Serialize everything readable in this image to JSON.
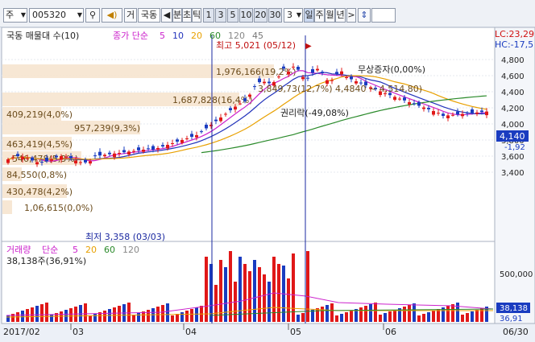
{
  "toolbar": {
    "market_select": "주",
    "code_input": "005320",
    "search_icon_name": "magnifier-icon",
    "sound_icon_name": "speaker-icon",
    "trade_btn": "거",
    "stock_name": "국동",
    "prev_arrow": "◀",
    "tick_btn": "분",
    "tick_btn2": "초",
    "tick_btn3": "틱",
    "periods": [
      "1",
      "3",
      "5",
      "10",
      "20",
      "30"
    ],
    "count_value": "3",
    "day_btn": "일",
    "week_btn": "주",
    "month_btn": "월",
    "year_btn": "년",
    "next_arrow": ">",
    "updown_icon_name": "updown-arrows-icon"
  },
  "price_panel": {
    "title": "국동 매물대 수(10)",
    "ma_label": "종가 단순",
    "ma_periods": [
      {
        "label": "5",
        "color": "#cc22cc"
      },
      {
        "label": "10",
        "color": "#2233bb"
      },
      {
        "label": "20",
        "color": "#e8a000"
      },
      {
        "label": "60",
        "color": "#2a8a2a"
      },
      {
        "label": "120",
        "color": "#888888"
      },
      {
        "label": "45",
        "color": "#777777"
      }
    ],
    "lc_label": "LC:23,29",
    "hc_label": "HC:-17,5",
    "high_annot": "최고 5,021 (05/12)",
    "low_annot": "최저 3,358 (03/03)",
    "bonus_annot": "무상증자(0,00%)",
    "rights_annot": "권리락(-49,08%)",
    "current_price": "4,140",
    "change_label": "-1,92",
    "y_ticks": [
      "4,800",
      "4,600",
      "4,400",
      "4,200",
      "4,000",
      "3,800",
      "3,600",
      "3,400"
    ],
    "volume_profile": [
      {
        "label": "1,976,166(19,2%)",
        "frac": 0.55
      },
      {
        "label": "1,687,828(16,4%)",
        "frac": 0.48
      },
      {
        "label": "409,219(4,0%)",
        "frac": 0.12
      },
      {
        "label": "957,239(9,3%)",
        "frac": 0.28
      },
      {
        "label": "463,419(4,5%)",
        "frac": 0.14
      },
      {
        "label": "546,478(5,3%)",
        "frac": 0.16
      },
      {
        "label": "84,550(0,8%)",
        "frac": 0.04
      },
      {
        "label": "430,478(4,2%)",
        "frac": 0.13
      },
      {
        "label": "1,06,615(0,0%)",
        "frac": 0.02
      }
    ],
    "range_annot": "3,849,73(12,7%) 4,4840 ~ 4,514,80)"
  },
  "volume_panel": {
    "title": "거래량",
    "ma_label": "단순",
    "ma_periods": [
      {
        "label": "5",
        "color": "#cc22cc"
      },
      {
        "label": "20",
        "color": "#e8a000"
      },
      {
        "label": "60",
        "color": "#2a8a2a"
      },
      {
        "label": "120",
        "color": "#888888"
      }
    ],
    "last_volume": "38,138주(36,91%)",
    "y_tick": "500,000",
    "current_volume": "38,138",
    "current_ratio": "36,91"
  },
  "x_axis": [
    "2017/02",
    "03",
    "04",
    "05",
    "06",
    "06/30"
  ]
}
